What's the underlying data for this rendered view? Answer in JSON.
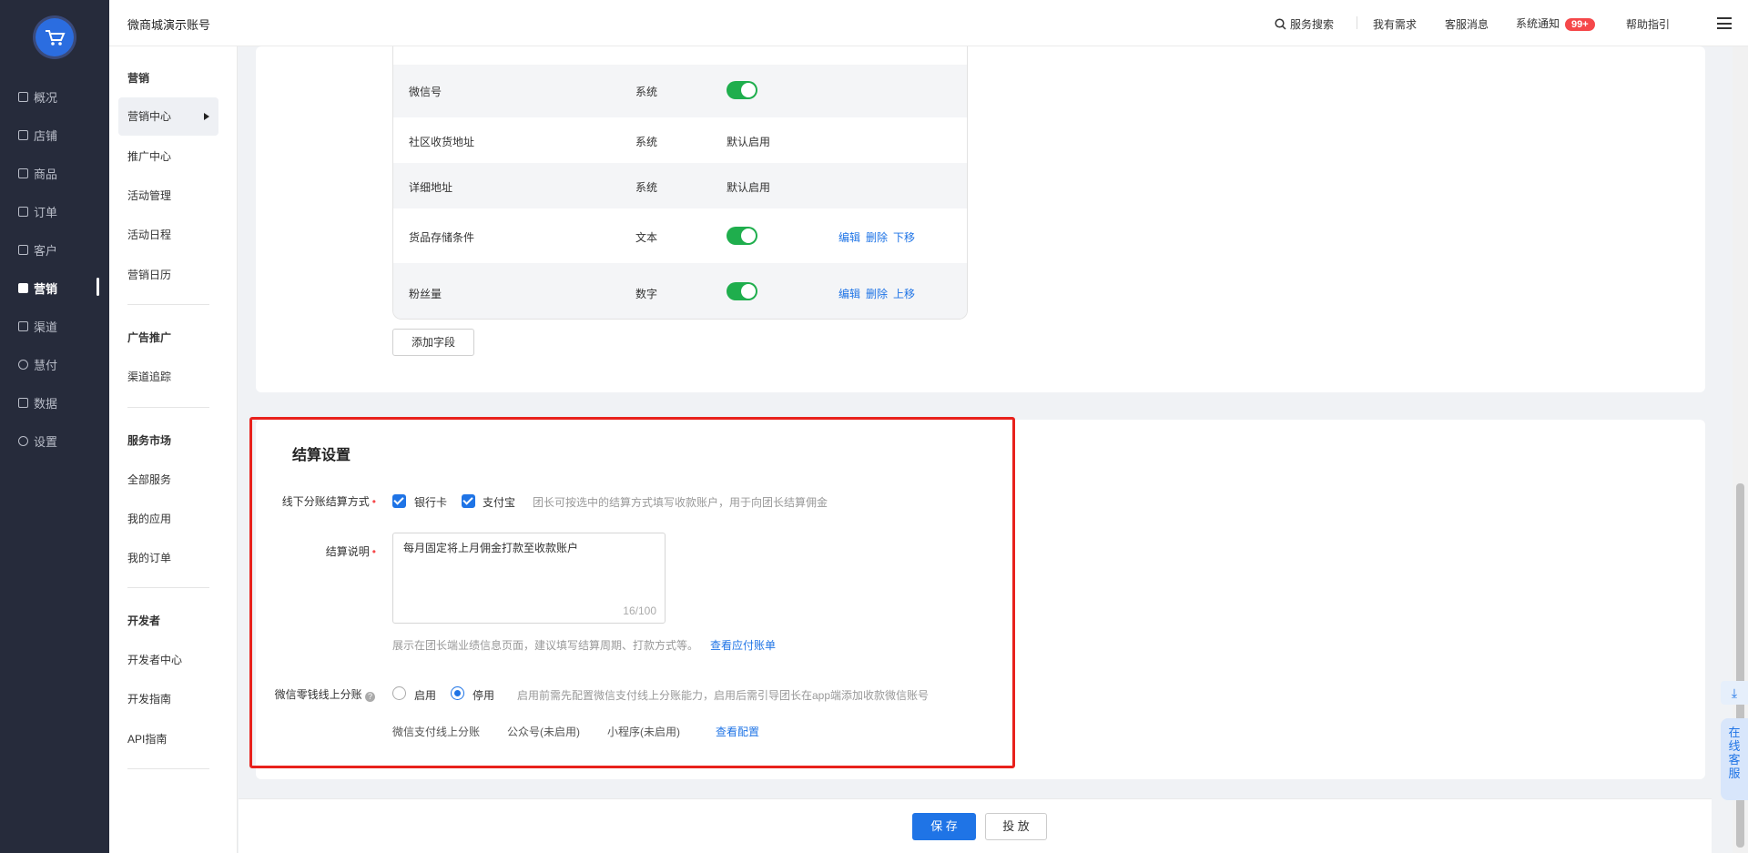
{
  "sidebar": {
    "items": [
      {
        "label": "概况",
        "icon": "overview-icon"
      },
      {
        "label": "店铺",
        "icon": "shop-icon"
      },
      {
        "label": "商品",
        "icon": "goods-icon"
      },
      {
        "label": "订单",
        "icon": "order-icon"
      },
      {
        "label": "客户",
        "icon": "customer-icon"
      },
      {
        "label": "营销",
        "icon": "marketing-icon",
        "active": true
      },
      {
        "label": "渠道",
        "icon": "channel-icon"
      },
      {
        "label": "慧付",
        "icon": "pay-icon"
      },
      {
        "label": "数据",
        "icon": "data-icon"
      },
      {
        "label": "设置",
        "icon": "settings-icon"
      }
    ]
  },
  "subnav": {
    "sections": [
      {
        "title": "营销",
        "items": [
          "营销中心",
          "推广中心",
          "活动管理",
          "活动日程",
          "营销日历"
        ]
      },
      {
        "title": "广告推广",
        "items": [
          "渠道追踪"
        ]
      },
      {
        "title": "服务市场",
        "items": [
          "全部服务",
          "我的应用",
          "我的订单"
        ]
      },
      {
        "title": "开发者",
        "items": [
          "开发者中心",
          "开发指南",
          "API指南"
        ]
      }
    ]
  },
  "header": {
    "brand": "微商城演示账号",
    "search": "服务搜索",
    "demand": "我有需求",
    "service_msg": "客服消息",
    "notice": "系统通知",
    "notice_badge": "99+",
    "help": "帮助指引"
  },
  "fields_table": {
    "rows": [
      {
        "name": "微信号",
        "type": "系统",
        "status": "toggle-on",
        "actions": []
      },
      {
        "name": "社区收货地址",
        "type": "系统",
        "status": "默认启用",
        "actions": []
      },
      {
        "name": "详细地址",
        "type": "系统",
        "status": "默认启用",
        "actions": []
      },
      {
        "name": "货品存储条件",
        "type": "文本",
        "status": "toggle-on",
        "actions": [
          "编辑",
          "删除",
          "下移"
        ]
      },
      {
        "name": "粉丝量",
        "type": "数字",
        "status": "toggle-on",
        "actions": [
          "编辑",
          "删除",
          "上移"
        ]
      }
    ],
    "add_button": "添加字段"
  },
  "settlement": {
    "title": "结算设置",
    "method_label": "线下分账结算方式",
    "opt_bank": "银行卡",
    "opt_alipay": "支付宝",
    "method_hint": "团长可按选中的结算方式填写收款账户，用于向团长结算佣金",
    "desc_label": "结算说明",
    "desc_value": "每月固定将上月佣金打款至收款账户",
    "desc_count": "16/100",
    "desc_hint": "展示在团长端业绩信息页面，建议填写结算周期、打款方式等。",
    "desc_link": "查看应付账单",
    "wx_label": "微信零钱线上分账",
    "wx_on": "启用",
    "wx_off": "停用",
    "wx_hint": "启用前需先配置微信支付线上分账能力，启用后需引导团长在app端添加收款微信账号",
    "wx_line_label": "微信支付线上分账",
    "wx_mp": "公众号(未启用)",
    "wx_mini": "小程序(未启用)",
    "wx_config_link": "查看配置"
  },
  "footer": {
    "save": "保 存",
    "cancel": "投 放"
  },
  "float": {
    "download": "⤓",
    "chat": "在线客服"
  },
  "colors": {
    "primary": "#1f74e6",
    "sidebar_bg": "#262b3b",
    "toggle_on": "#1fae4d",
    "highlight": "#e8211c"
  }
}
